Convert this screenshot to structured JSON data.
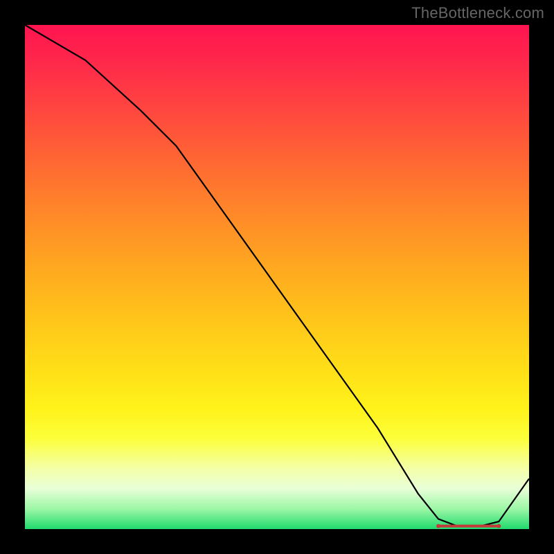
{
  "watermark": "TheBottleneck.com",
  "chart_data": {
    "type": "line",
    "title": "",
    "xlabel": "",
    "ylabel": "",
    "xlim": [
      0,
      100
    ],
    "ylim": [
      0,
      100
    ],
    "grid": false,
    "series": [
      {
        "name": "curve",
        "x": [
          0,
          12,
          23,
          30,
          40,
          50,
          60,
          70,
          78,
          82,
          86,
          90,
          94,
          100
        ],
        "values": [
          100,
          93,
          83,
          76,
          62,
          48,
          34,
          20,
          7,
          2,
          0.5,
          0.5,
          1.5,
          10
        ]
      }
    ],
    "highlight_range_x": [
      82,
      94
    ],
    "colors": {
      "gradient_top": "#ff1450",
      "gradient_bottom": "#20da6e",
      "curve": "#000000",
      "marker": "#c43a3a",
      "frame": "#000000"
    }
  }
}
